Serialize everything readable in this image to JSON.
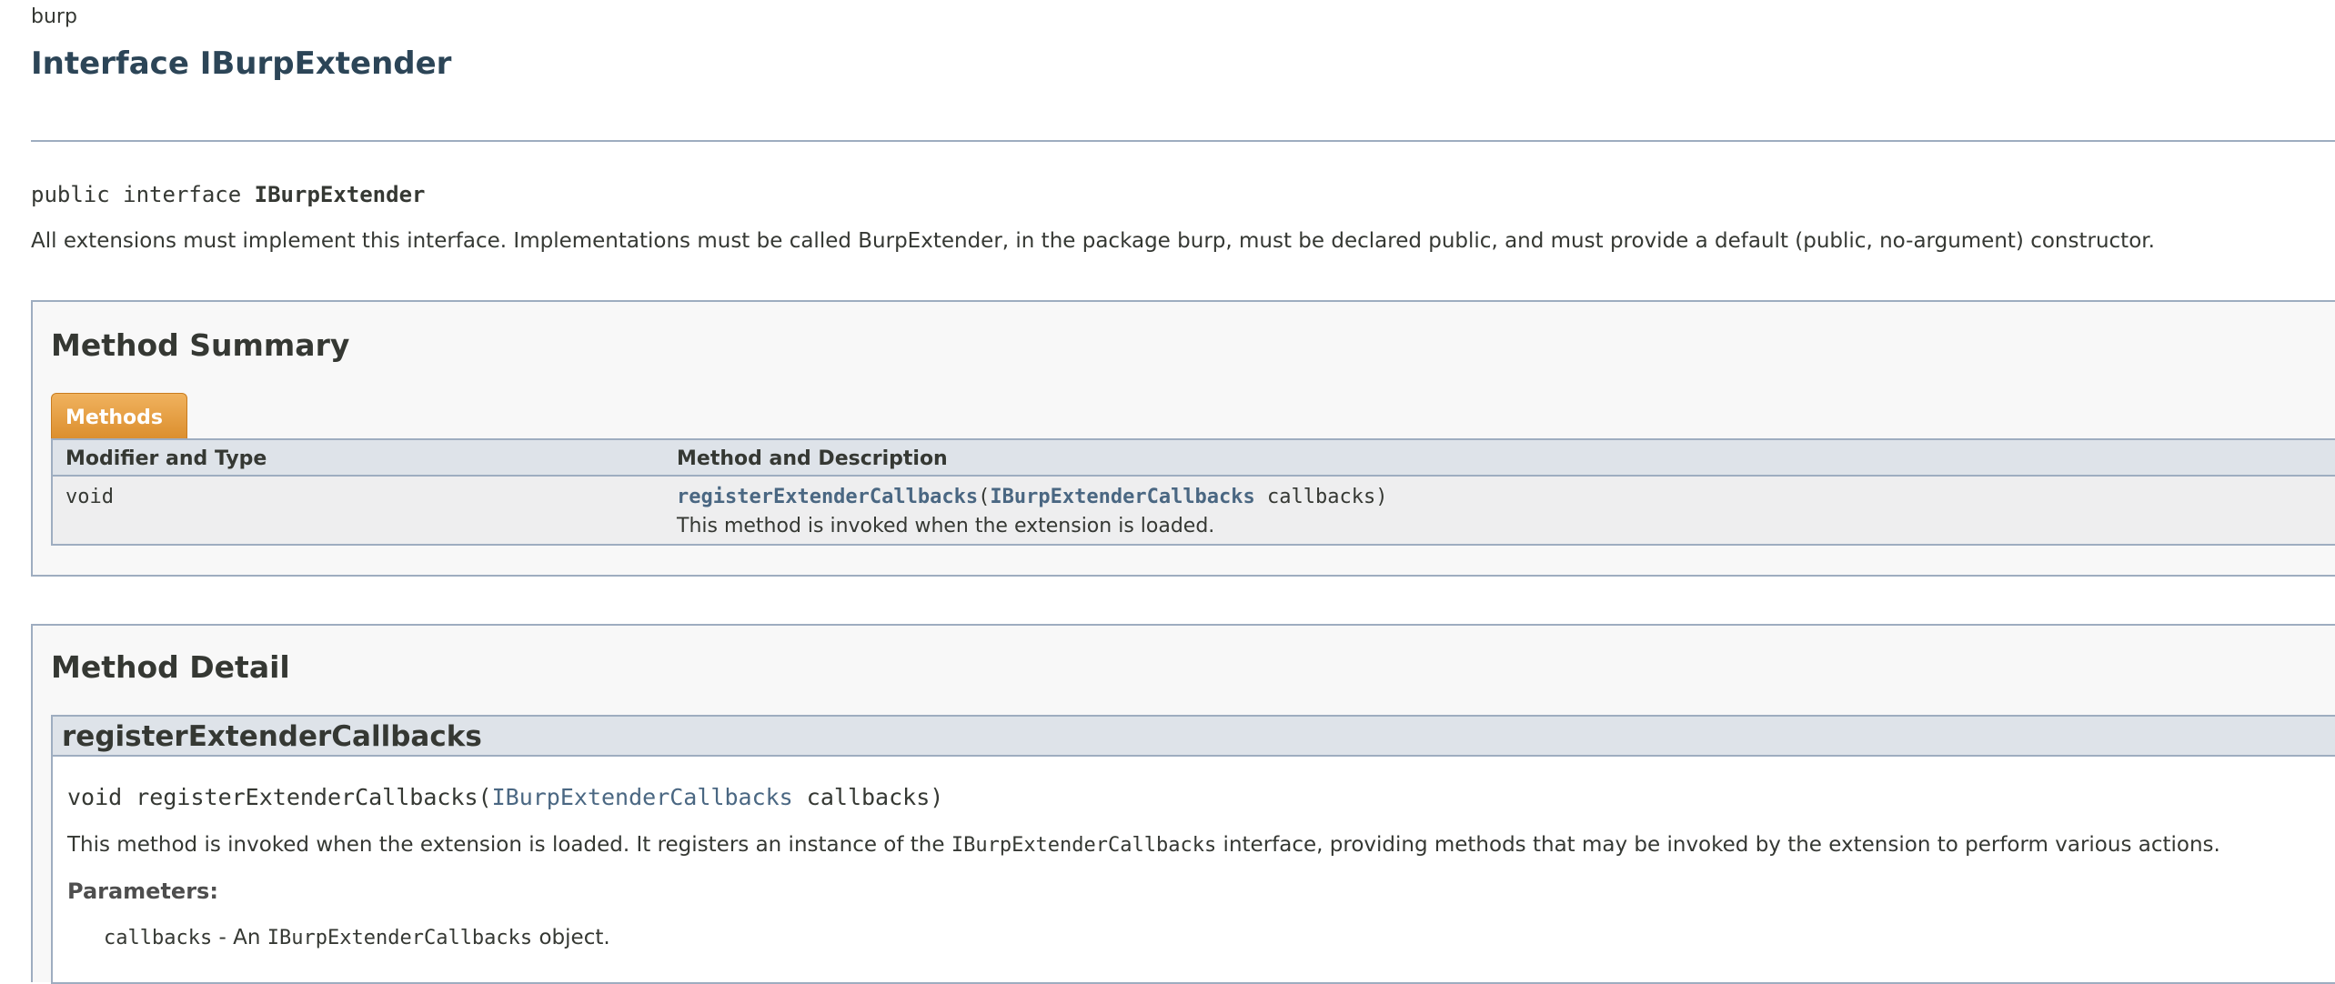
{
  "package": "burp",
  "title": "Interface IBurpExtender",
  "signature": {
    "prefix": "public interface ",
    "name": "IBurpExtender"
  },
  "description": "All extensions must implement this interface. Implementations must be called BurpExtender, in the package burp, must be declared public, and must provide a default (public, no-argument) constructor.",
  "method_summary": {
    "heading": "Method Summary",
    "tab_label": "Methods",
    "columns": [
      "Modifier and Type",
      "Method and Description"
    ],
    "rows": [
      {
        "type": "void",
        "method_name": "registerExtenderCallbacks",
        "param_type": "IBurpExtenderCallbacks",
        "param_name": "callbacks",
        "description": "This method is invoked when the extension is loaded."
      }
    ]
  },
  "method_detail": {
    "heading": "Method Detail",
    "method_name": "registerExtenderCallbacks",
    "signature_prefix": "void registerExtenderCallbacks(",
    "signature_param_type": "IBurpExtenderCallbacks",
    "signature_suffix": " callbacks)",
    "desc_before": "This method is invoked when the extension is loaded. It registers an instance of the ",
    "desc_code": "IBurpExtenderCallbacks",
    "desc_after": " interface, providing methods that may be invoked by the extension to perform various actions.",
    "params_label": "Parameters:",
    "param_name": "callbacks",
    "param_desc_before": " - An ",
    "param_desc_code": "IBurpExtenderCallbacks",
    "param_desc_after": " object."
  },
  "colors": {
    "title": "#2c4557",
    "link": "#4a6782",
    "tab": "#dc8f2e",
    "border": "#9eadc0",
    "table_header": "#dee3e9"
  }
}
